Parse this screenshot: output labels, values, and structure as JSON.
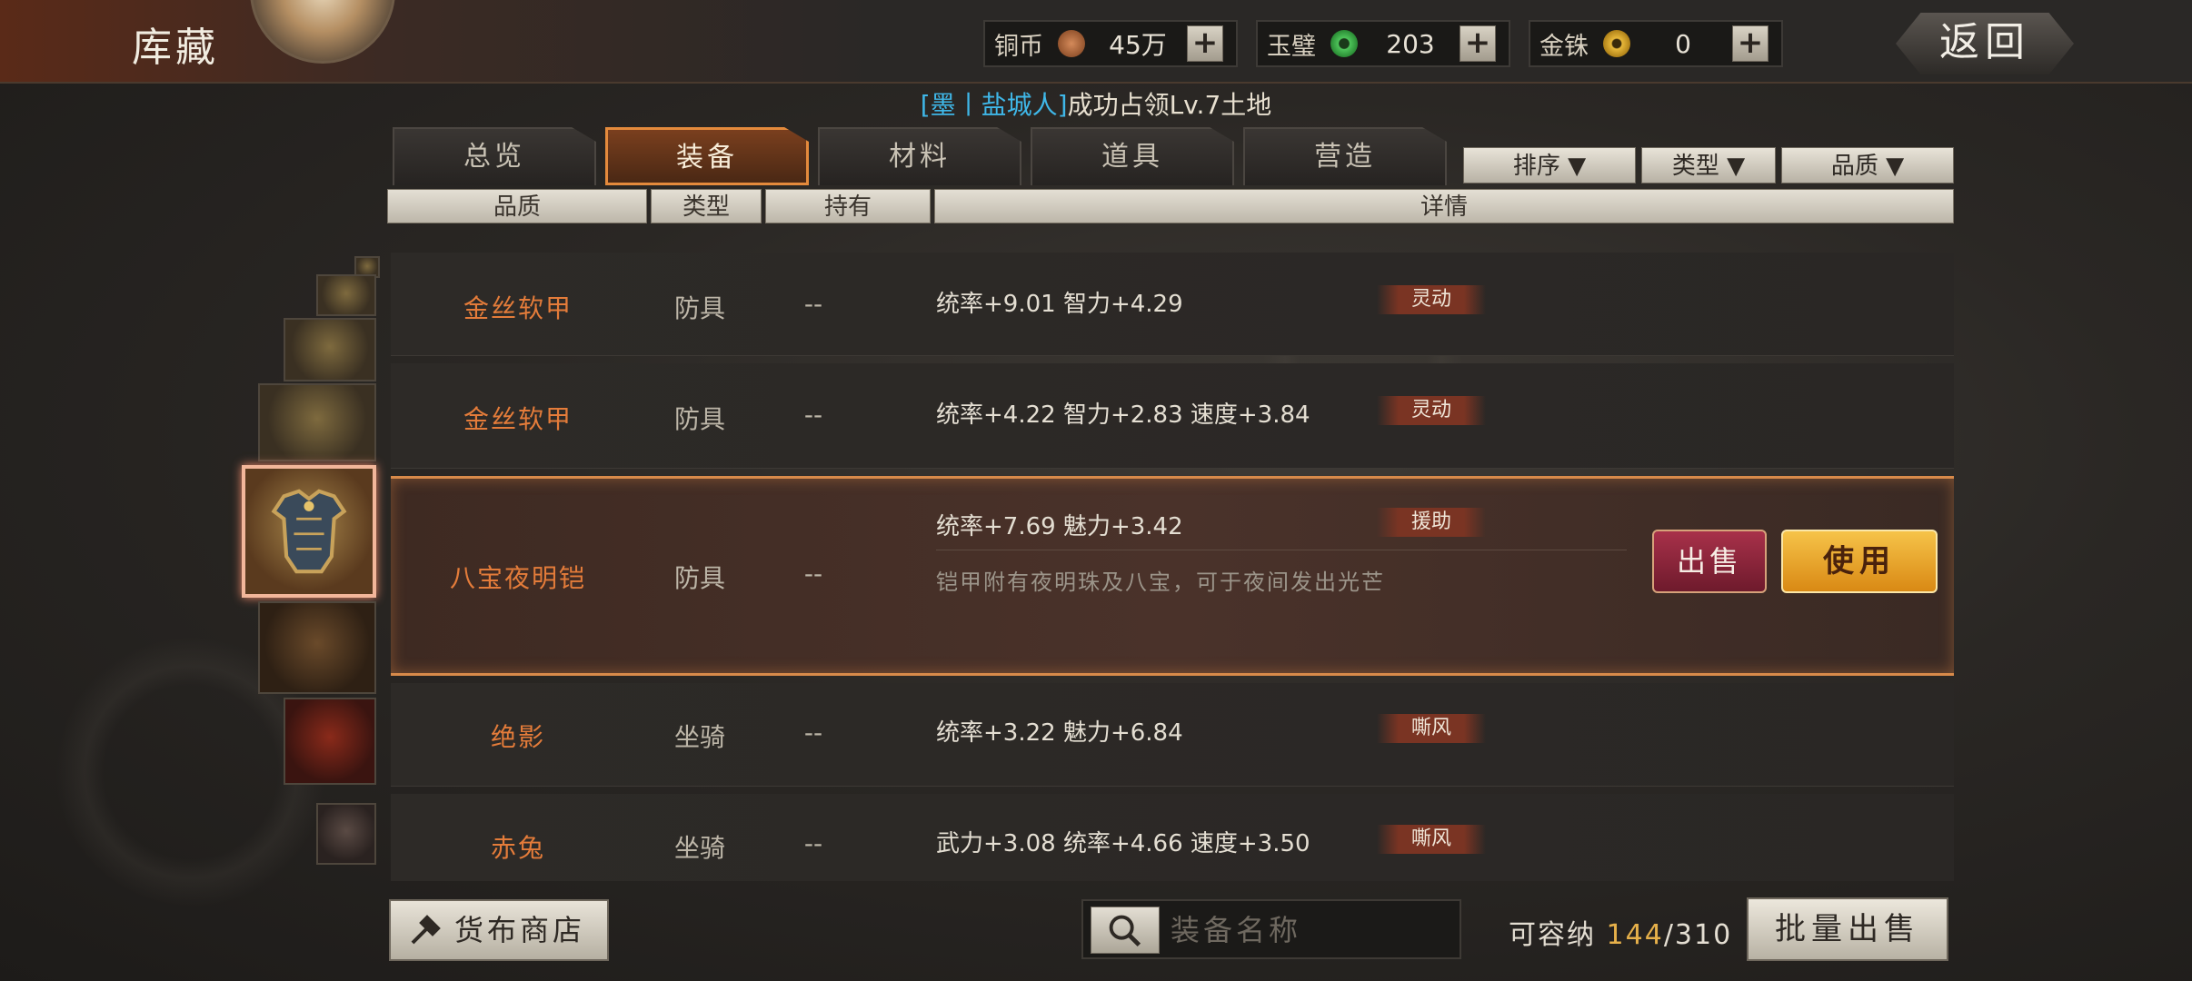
{
  "header": {
    "title": "库藏",
    "back_label": "返回",
    "currencies": [
      {
        "name": "铜币",
        "amount": "45万",
        "icon": "copper-coin-icon",
        "color": "#b0673a"
      },
      {
        "name": "玉璧",
        "amount": "203",
        "icon": "jade-disc-icon",
        "color": "#3fae4a"
      },
      {
        "name": "金铢",
        "amount": "0",
        "icon": "gold-coin-icon",
        "color": "#d2a42a"
      }
    ],
    "plus_label": "+"
  },
  "notice": {
    "prefix": "[墨丨盐城人]",
    "text": "成功占领Lv.7土地"
  },
  "tabs": [
    {
      "label": "总览",
      "active": false
    },
    {
      "label": "装备",
      "active": true
    },
    {
      "label": "材料",
      "active": false
    },
    {
      "label": "道具",
      "active": false
    },
    {
      "label": "营造",
      "active": false
    }
  ],
  "filters": [
    {
      "label": "排序 ▼"
    },
    {
      "label": "类型 ▼"
    },
    {
      "label": "品质 ▼"
    }
  ],
  "columns": [
    "品质",
    "类型",
    "持有",
    "详情"
  ],
  "items": [
    {
      "name": "金丝软甲",
      "type": "防具",
      "owner": "--",
      "stats": "统率+9.01  智力+4.29",
      "tag": "灵动"
    },
    {
      "name": "金丝软甲",
      "type": "防具",
      "owner": "--",
      "stats": "统率+4.22  智力+2.83  速度+3.84",
      "tag": "灵动"
    },
    {
      "name": "八宝夜明铠",
      "type": "防具",
      "owner": "--",
      "stats": "统率+7.69  魅力+3.42",
      "tag": "援助",
      "desc": "铠甲附有夜明珠及八宝，可于夜间发出光芒",
      "sell_label": "出售",
      "use_label": "使用"
    },
    {
      "name": "绝影",
      "type": "坐骑",
      "owner": "--",
      "stats": "统率+3.22  魅力+6.84",
      "tag": "嘶风"
    },
    {
      "name": "赤兔",
      "type": "坐骑",
      "owner": "--",
      "stats": "武力+3.08  统率+4.66  速度+3.50",
      "tag": "嘶风"
    }
  ],
  "footer": {
    "shop_label": "货布商店",
    "search_placeholder": "装备名称",
    "capacity_label": "可容纳",
    "capacity_current": "144",
    "capacity_total": "/310",
    "batch_sell_label": "批量出售"
  },
  "colors": {
    "accent_orange": "#e47c3a",
    "selected_border": "#d88a4a",
    "sell_red": "#a8314a",
    "use_gold": "#f6c349",
    "notice_blue": "#3fb7e8"
  }
}
